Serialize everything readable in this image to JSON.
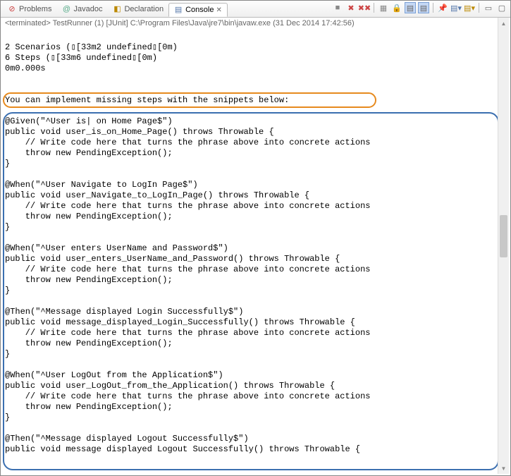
{
  "tabs": {
    "problems": "Problems",
    "javadoc": "Javadoc",
    "declaration": "Declaration",
    "console": "Console"
  },
  "status": "<terminated> TestRunner (1) [JUnit] C:\\Program Files\\Java\\jre7\\bin\\javaw.exe (31 Dec 2014 17:42:56)",
  "console": {
    "l1": "2 Scenarios (▯[33m2 undefined▯[0m)",
    "l2": "6 Steps (▯[33m6 undefined▯[0m)",
    "l3": "0m0.000s",
    "hint": "You can implement missing steps with the snippets below:",
    "s1a": "@Given(\"^User is| on Home Page$\")",
    "s1b": "public void user_is_on_Home_Page() throws Throwable {",
    "s1c": "    // Write code here that turns the phrase above into concrete actions",
    "s1d": "    throw new PendingException();",
    "s1e": "}",
    "s2a": "@When(\"^User Navigate to LogIn Page$\")",
    "s2b": "public void user_Navigate_to_LogIn_Page() throws Throwable {",
    "s2c": "    // Write code here that turns the phrase above into concrete actions",
    "s2d": "    throw new PendingException();",
    "s2e": "}",
    "s3a": "@When(\"^User enters UserName and Password$\")",
    "s3b": "public void user_enters_UserName_and_Password() throws Throwable {",
    "s3c": "    // Write code here that turns the phrase above into concrete actions",
    "s3d": "    throw new PendingException();",
    "s3e": "}",
    "s4a": "@Then(\"^Message displayed Login Successfully$\")",
    "s4b": "public void message_displayed_Login_Successfully() throws Throwable {",
    "s4c": "    // Write code here that turns the phrase above into concrete actions",
    "s4d": "    throw new PendingException();",
    "s4e": "}",
    "s5a": "@When(\"^User LogOut from the Application$\")",
    "s5b": "public void user_LogOut_from_the_Application() throws Throwable {",
    "s5c": "    // Write code here that turns the phrase above into concrete actions",
    "s5d": "    throw new PendingException();",
    "s5e": "}",
    "s6a": "@Then(\"^Message displayed Logout Successfully$\")",
    "s6b": "public void message displayed Logout Successfully() throws Throwable {"
  }
}
